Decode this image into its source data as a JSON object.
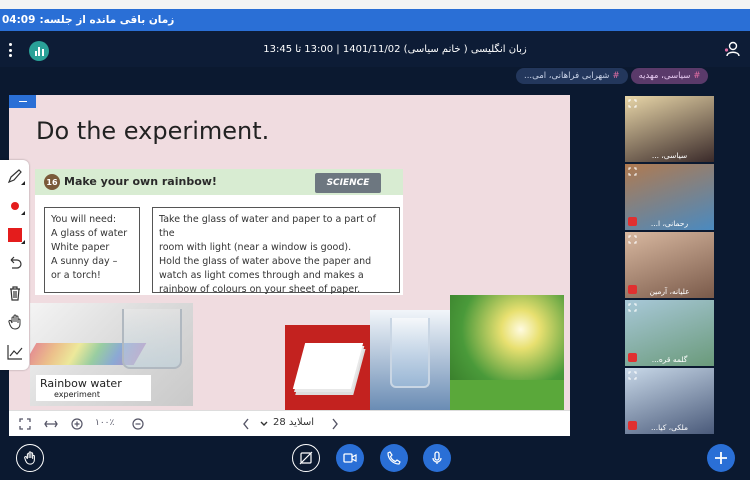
{
  "timer": {
    "label": "زمان باقی مانده از جلسه:",
    "value": "04:09"
  },
  "header": {
    "title": "زبان انگلیسی ( خانم سیاسی) 1401/11/02 | 13:00 تا 13:45"
  },
  "chips": [
    {
      "label": "سیاسی، مهدیه",
      "hash": "#"
    },
    {
      "label": "شهرابی فراهانی، امی...",
      "hash": "#"
    }
  ],
  "slide": {
    "title": "Do the experiment.",
    "activity_number": "16",
    "activity_heading": "Make your own rainbow!",
    "badge": "SCIENCE",
    "you_need": [
      "You will need:",
      "A glass of water",
      "White paper",
      "A sunny day –",
      "or a torch!"
    ],
    "instructions": [
      "Take the glass of water and paper to a part of the",
      "room with light (near a window is good).",
      "Hold the glass of water above the paper and",
      "watch as light comes through and makes a",
      "rainbow of colours on your sheet of paper."
    ],
    "caption_line1": "Rainbow water",
    "caption_line2": "experiment"
  },
  "slide_toolbar": {
    "zoom": "۱۰۰٪",
    "page_label": "اسلاید 28"
  },
  "participants": [
    {
      "name": "سیاسی، ...",
      "colors": [
        "#e8d6a8",
        "#3a2a2a"
      ]
    },
    {
      "name": "رحمانی، ا...",
      "colors": [
        "#b07a50",
        "#4a8ac0"
      ]
    },
    {
      "name": "علیانه، آرمین",
      "colors": [
        "#d8b8a0",
        "#7a5a4a"
      ]
    },
    {
      "name": "گلمه قره...",
      "colors": [
        "#a8c8d8",
        "#6a9a7a"
      ]
    },
    {
      "name": "ملکی، کیا...",
      "colors": [
        "#c8d8e8",
        "#4a5a7a"
      ]
    }
  ],
  "colors": {
    "accent": "#2a6fd6",
    "background": "#0b1930",
    "danger": "#e03030"
  }
}
